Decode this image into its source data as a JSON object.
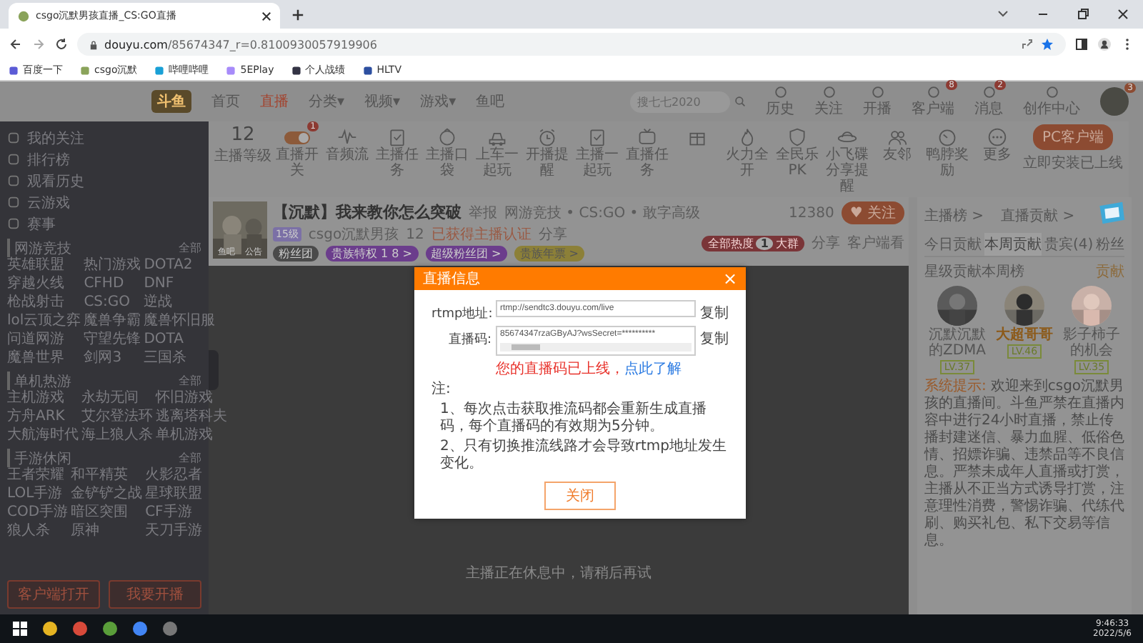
{
  "browser": {
    "tabs": [
      {
        "title": "csgo沉默男孩直播_CS:GO直播",
        "selected": true
      }
    ],
    "address_domain": "douyu.com",
    "address_path": "/85674347_r=0.8100930057919906",
    "bookmarks": [
      "百度一下",
      "csgo沉默",
      "哔哩哔哩",
      "5EPlay",
      "个人战绩",
      "HLTV"
    ]
  },
  "nav": {
    "logo": "斗鱼",
    "links": [
      {
        "label": "首页",
        "selected": false
      },
      {
        "label": "直播",
        "selected": true
      },
      {
        "label": "分类▾",
        "selected": false
      },
      {
        "label": "视频▾",
        "selected": false
      },
      {
        "label": "游戏▾",
        "selected": false
      },
      {
        "label": "鱼吧",
        "selected": false
      }
    ],
    "search": {
      "placeholder": "搜七七2020"
    },
    "actions": [
      {
        "label": "历史"
      },
      {
        "label": "关注"
      },
      {
        "label": "开播"
      },
      {
        "label": "客户端",
        "badge": "8"
      },
      {
        "label": "消息",
        "badge": "2"
      },
      {
        "label": "创作中心"
      }
    ],
    "avatar_badge": "3"
  },
  "toolbar": {
    "level": "12",
    "level_label": "主播等级",
    "tools": [
      {
        "kind": "toggle",
        "label": "直播开关",
        "badge": "1",
        "on": true
      },
      {
        "kind": "tool",
        "label": "音频流"
      },
      {
        "kind": "tool",
        "label": "主播任务"
      },
      {
        "kind": "tool",
        "label": "主播口袋"
      },
      {
        "kind": "tool",
        "label": "上车一起玩"
      },
      {
        "kind": "tool",
        "label": "开播提醒"
      },
      {
        "kind": "tool",
        "label": "主播一起玩"
      },
      {
        "kind": "tool",
        "label": "直播任务"
      },
      {
        "kind": "tool"
      },
      {
        "kind": "tool",
        "label": "火力全开"
      },
      {
        "kind": "tool",
        "label": "全民乐PK"
      },
      {
        "kind": "tool",
        "label": "小飞碟分享提醒"
      },
      {
        "kind": "tool",
        "label": "友邻"
      },
      {
        "kind": "tool",
        "label": "鸭脖奖励"
      },
      {
        "kind": "tool",
        "label": "更多"
      }
    ],
    "client_button": "PC客户端",
    "client_note": "立即安装已上线"
  },
  "sidebar": {
    "top": [
      "我的关注",
      "排行榜",
      "观看历史",
      "云游戏",
      "赛事"
    ],
    "groups": [
      {
        "title": "网游竞技",
        "more": "全部",
        "items": [
          "英雄联盟",
          "热门游戏",
          "DOTA2",
          "穿越火线",
          "CFHD",
          "DNF",
          "枪战射击",
          "CS:GO",
          "逆战",
          "lol云顶之弈",
          "魔兽争霸",
          "魔兽怀旧服",
          "问道网游",
          "守望先锋",
          "DOTA",
          "魔兽世界",
          "剑网3",
          "三国杀"
        ]
      },
      {
        "title": "单机热游",
        "more": "全部",
        "items": [
          "主机游戏",
          "永劫无间",
          "怀旧游戏",
          "方舟ARK",
          "艾尔登法环",
          "逃离塔科夫",
          "大航海时代",
          "海上狼人杀",
          "单机游戏"
        ]
      },
      {
        "title": "手游休闲",
        "more": "全部",
        "items": [
          "王者荣耀",
          "和平精英",
          "火影忍者",
          "LOL手游",
          "金铲铲之战",
          "星球联盟",
          "COD手游",
          "暗区突围",
          "CF手游",
          "狼人杀",
          "原神",
          "天刀手游"
        ]
      }
    ],
    "buttons": [
      "客户端打开",
      "我要开播"
    ]
  },
  "stream": {
    "thumb_labels": [
      "鱼吧",
      "公告"
    ],
    "title": "【沉默】我来教你怎么突破",
    "report": "举报",
    "category": "网游竞技 • CS:GO • 敢字高级",
    "level": "15级",
    "anchor": "csgo沉默男孩",
    "hot": "12",
    "cert": "已获得主播认证",
    "share_small": "分享",
    "badges": [
      "粉丝团",
      "贵族特权 1 8 >",
      "超级粉丝团 >",
      "贵族年票 >"
    ],
    "followers": "12380",
    "follow": "♥ 关注",
    "heat": [
      "全部热度",
      "1",
      "大群"
    ],
    "share": "分享",
    "client": "客户端看"
  },
  "video": {
    "message": "主播正在休息中，请稍后再试"
  },
  "panel": {
    "links": [
      "主播榜 >",
      "直播贡献 >"
    ],
    "tabs": [
      {
        "label": "今日贡献",
        "selected": false
      },
      {
        "label": "本周贡献",
        "selected": true
      },
      {
        "label": "贵宾(4)",
        "selected": false
      },
      {
        "label": "粉丝",
        "selected": false
      }
    ],
    "subtitle": "星级贡献本周榜",
    "more": "贡献",
    "top": [
      {
        "name": "沉默沉默的ZDMA",
        "level": "LV.37",
        "highlight": false
      },
      {
        "name": "大超哥哥",
        "level": "LV.46",
        "highlight": true
      },
      {
        "name": "影子柿子的机会",
        "level": "LV.35",
        "highlight": false
      }
    ],
    "notice_tag": "系统提示:",
    "notice": "欢迎来到csgo沉默男孩的直播间。斗鱼严禁在直播内容中进行24小时直播，禁止传播封建迷信、暴力血腥、低俗色情、招嫖诈骗、违禁品等不良信息。严禁未成年人直播或打赏，主播从不正当方式诱导打赏，注意理性消费，警惕诈骗、代练代刷、购买礼包、私下交易等信息。"
  },
  "dialog": {
    "title": "直播信息",
    "close": "×",
    "fields": [
      {
        "label": "rtmp地址:",
        "value": "rtmp://sendtc3.douyu.com/live",
        "copy": "复制"
      },
      {
        "label": "直播码:",
        "value": "85674347rzaGByAJ?wsSecret=**********",
        "copy": "复制"
      }
    ],
    "warning": "您的直播码已上线，",
    "learn": "点此了解",
    "note_title": "注:",
    "notes": [
      "1、每次点击获取推流码都会重新生成直播码，每个直播码的有效期为5分钟。",
      "2、只有切换推流线路才会导致rtmp地址发生变化。"
    ],
    "button": "关闭"
  },
  "taskbar": {
    "time": "9:46:33",
    "date": "2022/5/6"
  }
}
